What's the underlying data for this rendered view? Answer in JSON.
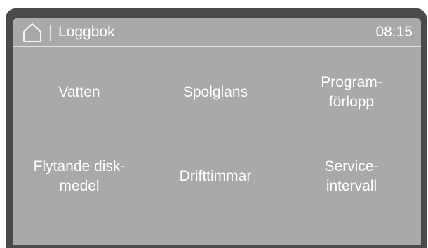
{
  "header": {
    "title": "Loggbok",
    "time": "08:15",
    "home_icon": "home-icon"
  },
  "menu": {
    "items": [
      {
        "label": "Vatten"
      },
      {
        "label": "Spolglans"
      },
      {
        "label": "Program-\nförlopp"
      },
      {
        "label": "Flytande disk-\nmedel"
      },
      {
        "label": "Drifttimmar"
      },
      {
        "label": "Service-\nintervall"
      }
    ]
  },
  "colors": {
    "screen_background": "#a9a9a9",
    "frame": "#4a4a4a",
    "text": "#ffffff"
  }
}
